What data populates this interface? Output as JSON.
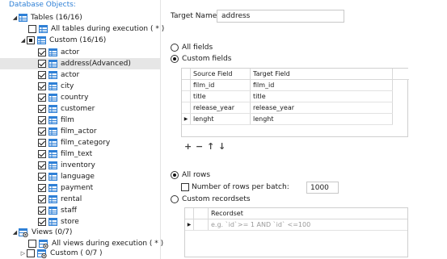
{
  "left_panel": {
    "section_title": "Database Objects:",
    "tables_node": "Tables (16/16)",
    "all_tables_exec": "All tables during execution ( * )",
    "custom_node": "Custom (16/16)",
    "tables": [
      {
        "label": "actor",
        "selected": false
      },
      {
        "label": "address(Advanced)",
        "selected": true
      },
      {
        "label": "actor",
        "selected": false
      },
      {
        "label": "city",
        "selected": false
      },
      {
        "label": "country",
        "selected": false
      },
      {
        "label": "customer",
        "selected": false
      },
      {
        "label": "film",
        "selected": false
      },
      {
        "label": "film_actor",
        "selected": false
      },
      {
        "label": "film_category",
        "selected": false
      },
      {
        "label": "film_text",
        "selected": false
      },
      {
        "label": "inventory",
        "selected": false
      },
      {
        "label": "language",
        "selected": false
      },
      {
        "label": "payment",
        "selected": false
      },
      {
        "label": "rental",
        "selected": false
      },
      {
        "label": "staff",
        "selected": false
      },
      {
        "label": "store",
        "selected": false
      }
    ],
    "views_node": "Views (0/7)",
    "all_views_exec": "All views during execution ( * )",
    "custom_views_node": "Custom ( 0/7 )"
  },
  "right_panel": {
    "target_name_label": "Target Name:",
    "target_name_value": "address",
    "all_fields_label": "All fields",
    "custom_fields_label": "Custom fields",
    "fields_grid": {
      "columns": [
        "Source Field",
        "Target Field"
      ],
      "rows": [
        [
          "film_id",
          "film_id"
        ],
        [
          "title",
          "title"
        ],
        [
          "release_year",
          "release_year"
        ],
        [
          "lenght",
          "lenght"
        ]
      ]
    },
    "toolbar": {
      "add": "+",
      "remove": "−",
      "up": "↑",
      "down": "↓"
    },
    "all_rows_label": "All rows",
    "rows_per_batch_label": "Number of rows per batch:",
    "rows_per_batch_value": "1000",
    "custom_recordsets_label": "Custom recordsets",
    "recordset_grid": {
      "column": "Recordset",
      "placeholder": "e.g. `id`>= 1 AND `id` <=100"
    }
  },
  "colors": {
    "accent": "#2f80d6",
    "selected_row": "#e6e6e6",
    "table_icon": "#2f80d6"
  }
}
